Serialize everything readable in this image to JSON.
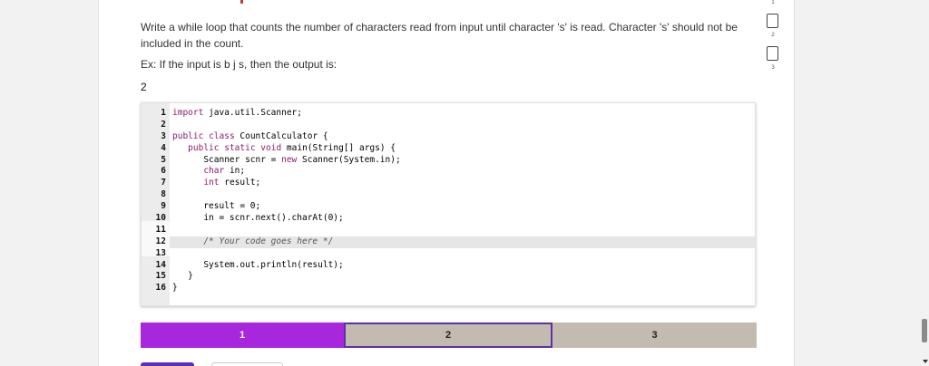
{
  "question": {
    "prompt": "Write a while loop that counts the number of characters read from input until character 's' is read. Character 's' should not be included in the count.",
    "example": "Ex: If the input is b j s, then the output is:",
    "expected_output": "2"
  },
  "editor": {
    "lines": [
      {
        "num": "1",
        "code": "import java.util.Scanner;"
      },
      {
        "num": "2",
        "code": ""
      },
      {
        "num": "3",
        "code": "public class CountCalculator {"
      },
      {
        "num": "4",
        "code": "   public static void main(String[] args) {"
      },
      {
        "num": "5",
        "code": "      Scanner scnr = new Scanner(System.in);"
      },
      {
        "num": "6",
        "code": "      char in;"
      },
      {
        "num": "7",
        "code": "      int result;"
      },
      {
        "num": "8",
        "code": ""
      },
      {
        "num": "9",
        "code": "      result = 0;"
      },
      {
        "num": "10",
        "code": "      in = scnr.next().charAt(0);"
      },
      {
        "num": "11",
        "code": ""
      },
      {
        "num": "12",
        "code": "      /* Your code goes here */"
      },
      {
        "num": "13",
        "code": ""
      },
      {
        "num": "14",
        "code": "      System.out.println(result);"
      },
      {
        "num": "15",
        "code": "   }"
      },
      {
        "num": "16",
        "code": "}"
      }
    ],
    "active_line": 12
  },
  "progress": {
    "steps": [
      {
        "label": "1",
        "state": "completed"
      },
      {
        "label": "2",
        "state": "current"
      },
      {
        "label": "3",
        "state": "pending"
      }
    ]
  },
  "side_nav": {
    "items": [
      "1",
      "2",
      "3"
    ]
  },
  "colors": {
    "completed": "#a827dd",
    "pending": "#c3bbb0",
    "current_border": "#5c2fa8"
  }
}
